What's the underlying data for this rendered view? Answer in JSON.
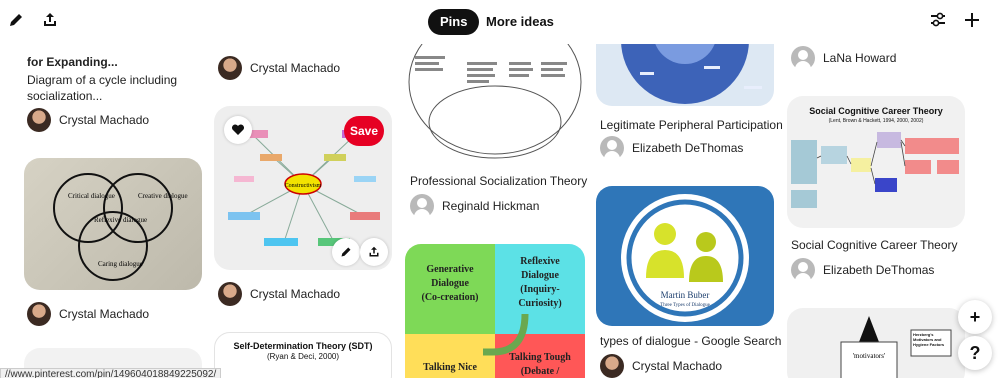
{
  "toolbar": {
    "edit_icon": "pencil-icon",
    "share_icon": "share-icon",
    "tabs": [
      "Pins",
      "More ideas"
    ],
    "filter_icon": "filter-icon",
    "add_icon": "plus-icon"
  },
  "col1": {
    "pin1_title": "for Expanding...",
    "pin1_desc": "Diagram of a cycle including socialization...",
    "pin1_user": "Crystal Machado",
    "venn_labels": [
      "Critical dialogue",
      "Creative dialogue",
      "Reflexive dialogue",
      "Caring dialogue"
    ],
    "pin2_user": "Crystal Machado"
  },
  "col2": {
    "pin1_user": "Crystal Machado",
    "save_label": "Save",
    "mindmap_center": "Constructivism",
    "pin2_user": "Crystal Machado",
    "pin3_title": "Self-Determination Theory (SDT)",
    "pin3_sub": "(Ryan & Deci, 2000)"
  },
  "col3": {
    "pin1_title": "Professional Socialization Theory",
    "pin1_user": "Reginald Hickman",
    "quad": [
      "Generative Dialogue (Co-creation)",
      "Reflexive Dialogue (Inquiry-Curiosity)",
      "Talking Nice",
      "Talking Tough (Debate /"
    ]
  },
  "col4": {
    "pin1_title": "Legitimate Peripheral Participation",
    "pin1_user": "Elizabeth DeThomas",
    "buber_name": "Martin Buber",
    "buber_sub": "Three Types of Dialogue",
    "pin2_title": "types of dialogue - Google Search",
    "pin2_user": "Crystal Machado"
  },
  "col5": {
    "pin1_user": "LaNa Howard",
    "sct_title": "Social Cognitive Career Theory",
    "sct_sub": "(Lent, Brown & Hackett, 1994, 2000, 2002)",
    "pin2_title": "Social Cognitive Career Theory",
    "pin2_user": "Elizabeth DeThomas",
    "pin3_caption": "Herzberg's Motivators and Hygiene Factors",
    "pin3_label": "'motivators'"
  },
  "floating": {
    "add_label": "+",
    "help_label": "?"
  },
  "status_url": "//www.pinterest.com/pin/149604018849225092/",
  "colors": {
    "save_red": "#e60023",
    "quad_green": "#7ed957",
    "quad_cyan": "#5ce1e6",
    "quad_yellow": "#ffde59",
    "quad_red": "#ff5757"
  }
}
